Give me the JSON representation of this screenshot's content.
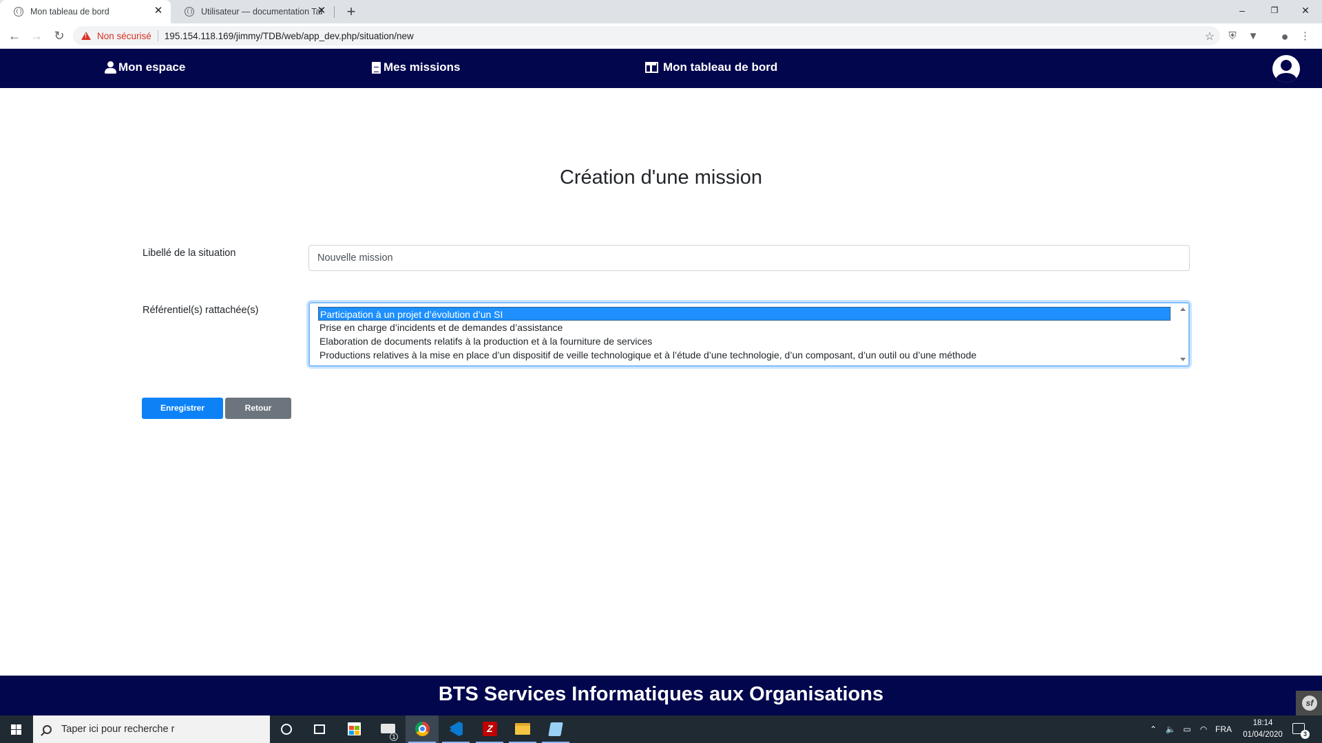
{
  "browser": {
    "tabs": [
      {
        "title": "Mon tableau de bord",
        "active": true
      },
      {
        "title": "Utilisateur — documentation Tab",
        "active": false
      }
    ],
    "new_tab": "+",
    "security_label": "Non sécurisé",
    "url": "195.154.118.169/jimmy/TDB/web/app_dev.php/situation/new",
    "window_controls": [
      "–",
      "❐",
      "✕"
    ]
  },
  "navbar": {
    "items": [
      {
        "label": "Mon espace",
        "icon": "user-icon"
      },
      {
        "label": "Mes missions",
        "icon": "file-icon"
      },
      {
        "label": "Mon tableau de bord",
        "icon": "columns-icon"
      }
    ],
    "avatar_icon": "user-circle-icon",
    "color": "#02064d"
  },
  "form": {
    "title": "Création d'une mission",
    "label_field": "Libellé de la situation",
    "label_value": "Nouvelle mission",
    "referentiel_label": "Référentiel(s) rattachée(s)",
    "options": [
      "Participation à un projet d’évolution d’un SI",
      "Prise en charge d’incidents et de demandes d’assistance",
      "Elaboration de documents relatifs à la production et à la fourniture de services",
      "Productions relatives à la mise en place d’un dispositif de veille technologique et à l’étude d’une technologie, d’un composant, d’un outil ou d’une méthode"
    ],
    "selected_option_index": 0,
    "save_button": "Enregistrer",
    "back_button": "Retour",
    "primary_color": "#0d82f7",
    "secondary_color": "#6c757d"
  },
  "footer": {
    "text": "BTS Services Informatiques aux Organisations"
  },
  "taskbar": {
    "search_placeholder": "Taper ici pour recherche r",
    "mail_badge": "1",
    "language": "FRA",
    "time": "18:14",
    "date": "01/04/2020",
    "notification_count": "3"
  }
}
